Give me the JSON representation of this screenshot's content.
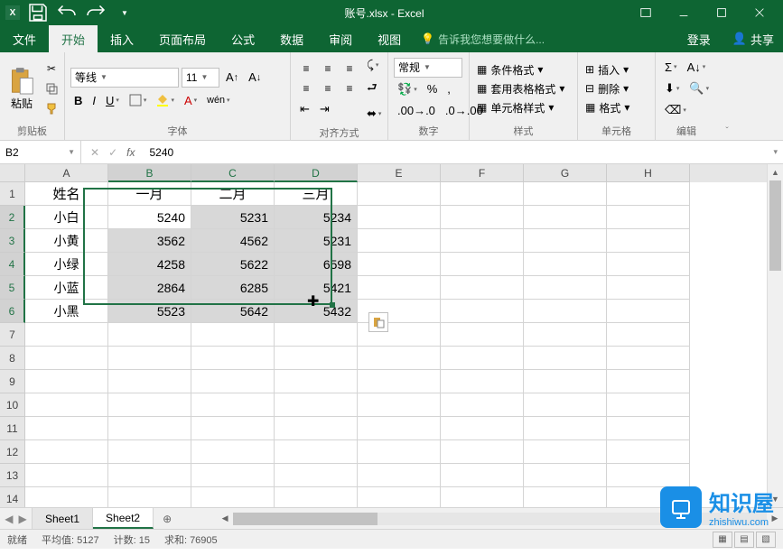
{
  "title": "账号.xlsx - Excel",
  "menus": {
    "file": "文件",
    "home": "开始",
    "insert": "插入",
    "pagelayout": "页面布局",
    "formulas": "公式",
    "data": "数据",
    "review": "审阅",
    "view": "视图"
  },
  "tellme": "告诉我您想要做什么...",
  "login": "登录",
  "share": "共享",
  "ribbon": {
    "clipboard": {
      "paste": "粘贴",
      "label": "剪贴板"
    },
    "font": {
      "name": "等线",
      "size": "11",
      "label": "字体"
    },
    "alignment": {
      "label": "对齐方式"
    },
    "number": {
      "combo": "常规",
      "label": "数字"
    },
    "styles": {
      "cond": "条件格式",
      "table": "套用表格格式",
      "cell": "单元格样式",
      "label": "样式"
    },
    "cells": {
      "insert": "插入",
      "delete": "删除",
      "format": "格式",
      "label": "单元格"
    },
    "editing": {
      "label": "编辑"
    }
  },
  "namebox": "B2",
  "formula": "5240",
  "cols": [
    "A",
    "B",
    "C",
    "D",
    "E",
    "F",
    "G",
    "H"
  ],
  "rows": [
    "1",
    "2",
    "3",
    "4",
    "5",
    "6",
    "7",
    "8",
    "9",
    "10",
    "11",
    "12",
    "13",
    "14"
  ],
  "headers": {
    "name": "姓名",
    "m1": "一月",
    "m2": "二月",
    "m3": "三月"
  },
  "data_rows": [
    {
      "name": "小白",
      "m1": "5240",
      "m2": "5231",
      "m3": "5234"
    },
    {
      "name": "小黄",
      "m1": "3562",
      "m2": "4562",
      "m3": "5231"
    },
    {
      "name": "小绿",
      "m1": "4258",
      "m2": "5622",
      "m3": "6598"
    },
    {
      "name": "小蓝",
      "m1": "2864",
      "m2": "6285",
      "m3": "5421"
    },
    {
      "name": "小黑",
      "m1": "5523",
      "m2": "5642",
      "m3": "5432"
    }
  ],
  "sheets": {
    "s1": "Sheet1",
    "s2": "Sheet2"
  },
  "status": {
    "ready": "就绪",
    "avg": "平均值: 5127",
    "count": "计数: 15",
    "sum": "求和: 76905"
  },
  "watermark": {
    "brand": "知识屋",
    "url": "zhishiwu.com"
  },
  "chart_data": {
    "type": "table",
    "title": "",
    "columns": [
      "姓名",
      "一月",
      "二月",
      "三月"
    ],
    "rows": [
      [
        "小白",
        5240,
        5231,
        5234
      ],
      [
        "小黄",
        3562,
        4562,
        5231
      ],
      [
        "小绿",
        4258,
        5622,
        6598
      ],
      [
        "小蓝",
        2864,
        6285,
        5421
      ],
      [
        "小黑",
        5523,
        5642,
        5432
      ]
    ]
  }
}
